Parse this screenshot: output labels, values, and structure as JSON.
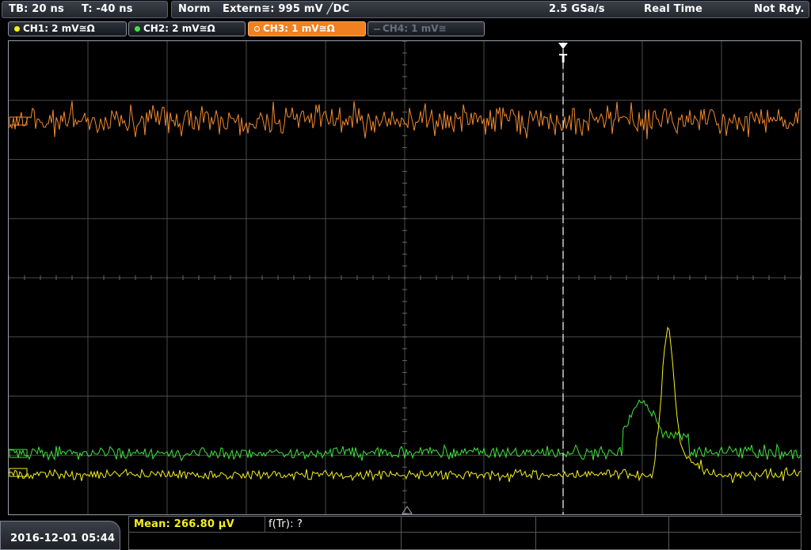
{
  "status": {
    "timebase": "TB: 20 ns",
    "trigger_time": "T: -40 ns",
    "mode": "Norm",
    "trigger_source": "Extern≅: 995 mV ╱DC",
    "sample_rate": "2.5 GSa/s",
    "acq_mode": "Real Time",
    "state": "Not Rdy."
  },
  "channels": [
    {
      "label": "CH1: 2 mV≅Ω",
      "color": "#f5f01e",
      "state": "on"
    },
    {
      "label": "CH2: 2 mV≅Ω",
      "color": "#3ee53e",
      "state": "on"
    },
    {
      "label": "CH3: 1 mV≅Ω",
      "color": "#f28a2e",
      "state": "active"
    },
    {
      "label": "CH4: 1 mV≅",
      "color": "#555a64",
      "state": "off"
    }
  ],
  "trigger_marker": "T",
  "timestamp": "2016-12-01 05:44",
  "measurements": {
    "mean": "Mean: 266.80 µV",
    "ftr": "f(Tr): ?"
  },
  "colors": {
    "ch1": "#f5f01e",
    "ch2": "#3ee53e",
    "ch3": "#f28a2e",
    "grid": "#4a4a4a"
  }
}
